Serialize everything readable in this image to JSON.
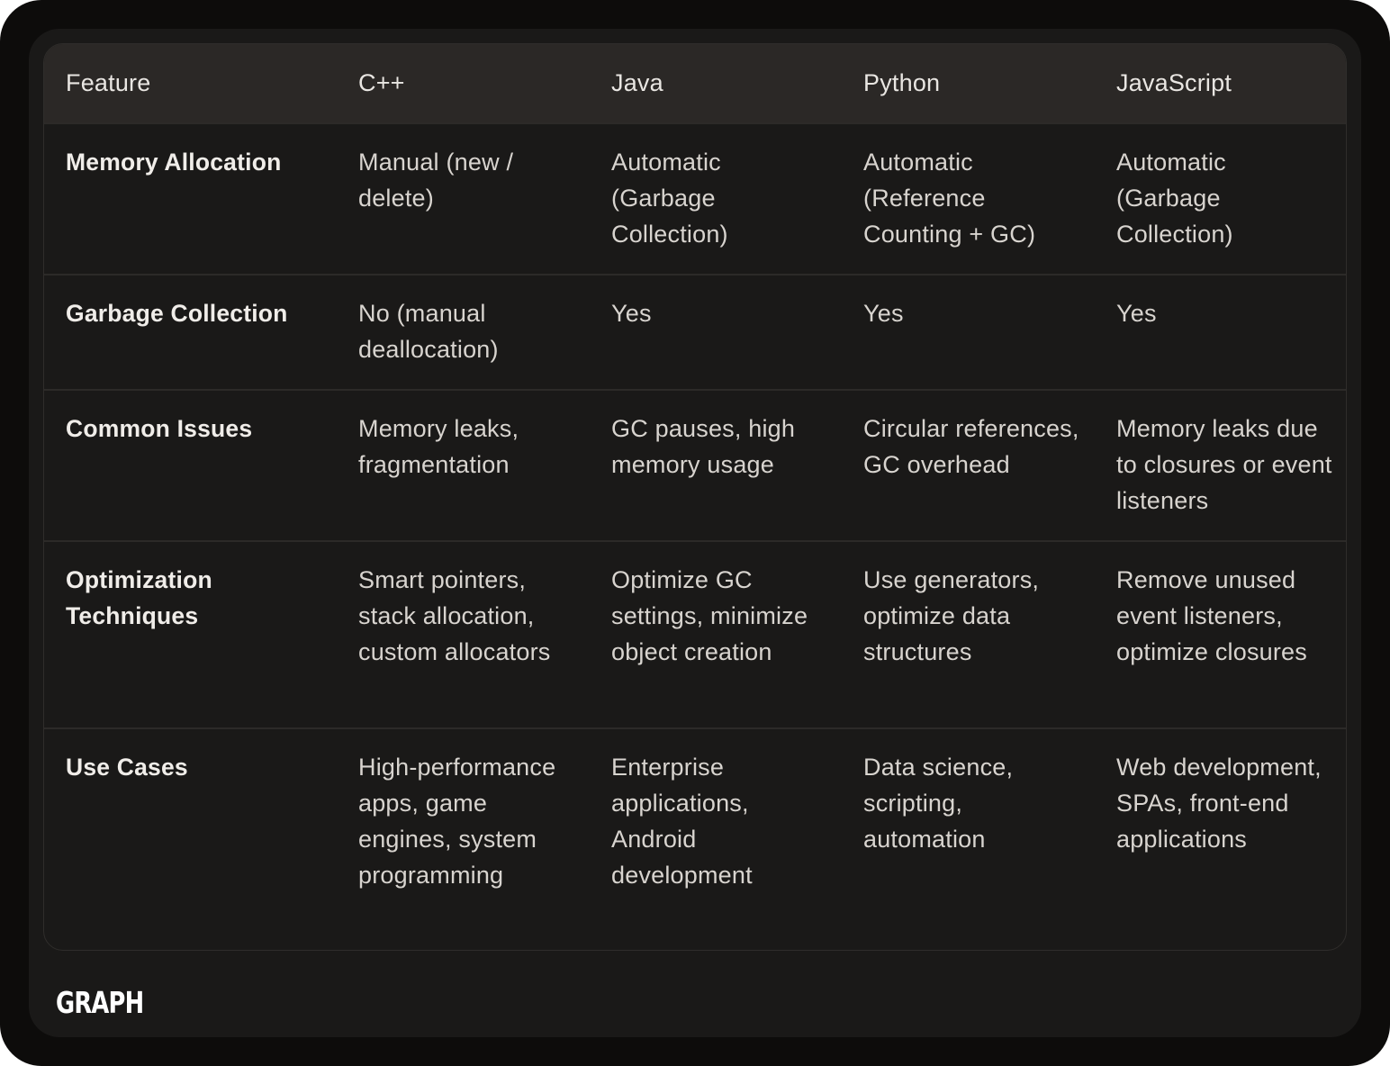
{
  "table": {
    "headers": [
      "Feature",
      "C++",
      "Java",
      "Python",
      "JavaScript"
    ],
    "rows": [
      [
        "Memory Allocation",
        "Manual (new / delete)",
        "Automatic (Garbage Collection)",
        "Automatic (Reference Counting + GC)",
        "Automatic (Garbage Collection)"
      ],
      [
        "Garbage Collection",
        "No (manual deallocation)",
        "Yes",
        "Yes",
        "Yes"
      ],
      [
        "Common Issues",
        "Memory leaks, fragmentation",
        "GC pauses, high memory usage",
        "Circular references, GC overhead",
        "Memory leaks due to closures or event listeners"
      ],
      [
        "Optimization Techniques",
        "Smart pointers, stack allocation, custom allocators",
        "Optimize GC settings, minimize object creation",
        "Use generators, optimize data structures",
        "Remove unused event listeners, optimize closures"
      ],
      [
        "Use Cases",
        "High-performance apps, game engines, system programming",
        "Enterprise applications, Android development",
        "Data science, scripting, automation",
        "Web development, SPAs, front-end applications"
      ]
    ]
  },
  "footer": {
    "logo": "GRAPH"
  },
  "colors": {
    "frame": "#0d0c0b",
    "panel": "#1a1918",
    "header_row": "#2b2826",
    "text": "#d8d4cf"
  }
}
